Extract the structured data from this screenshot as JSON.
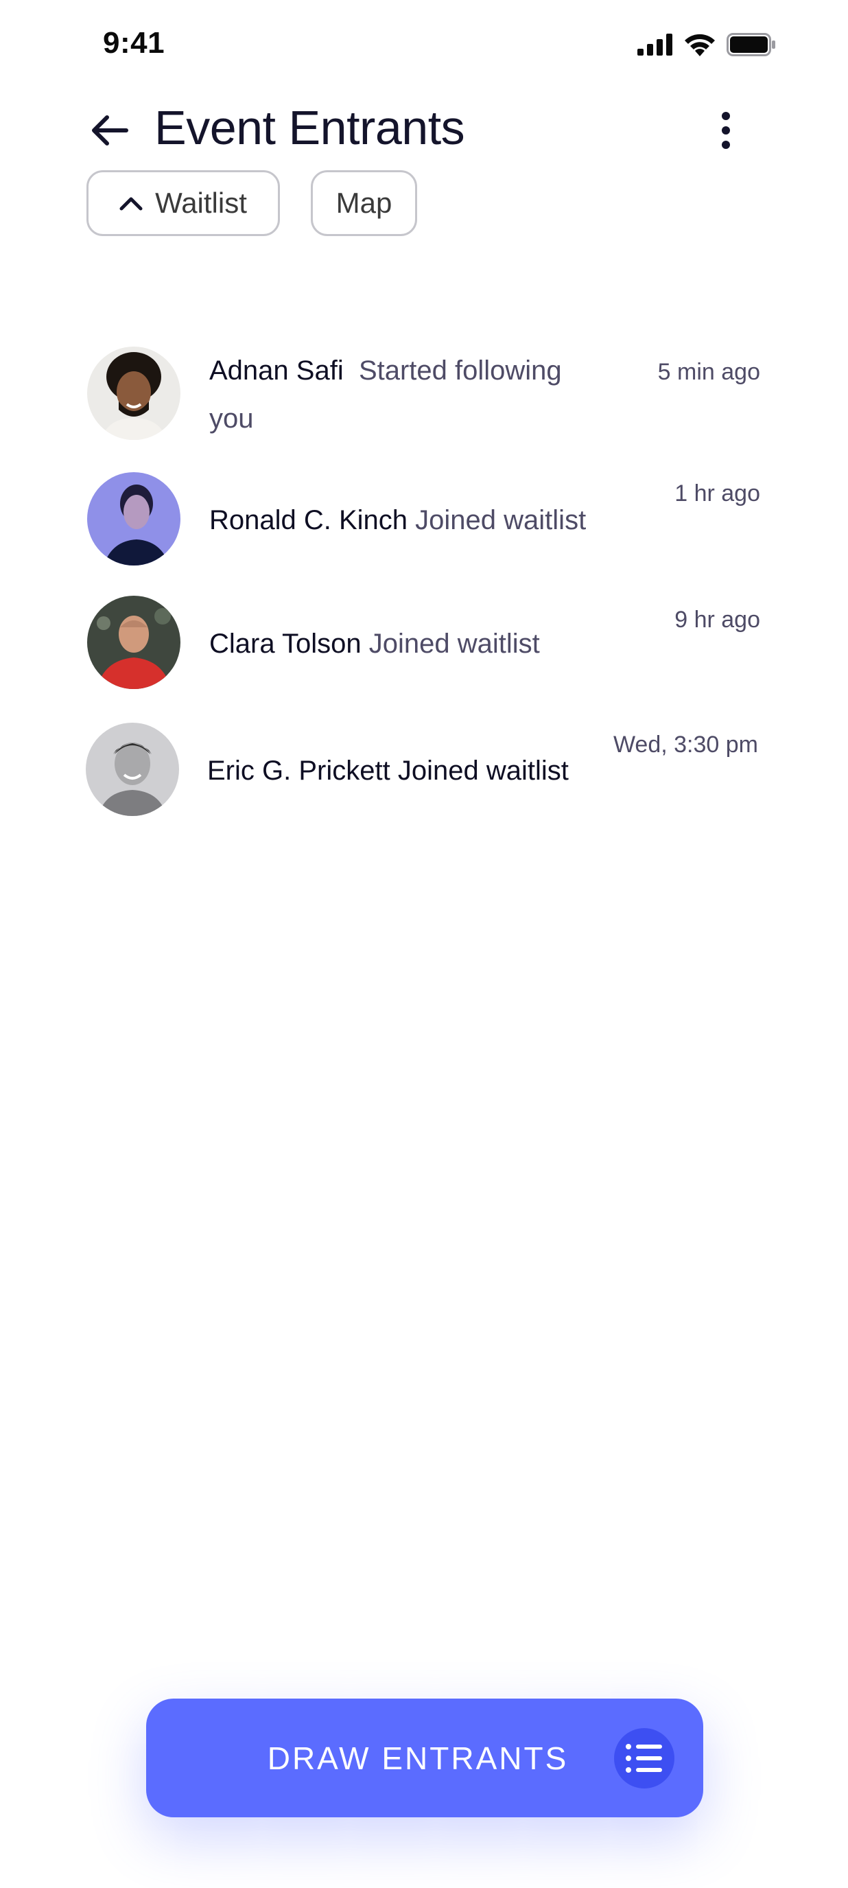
{
  "status_bar": {
    "time": "9:41"
  },
  "header": {
    "title": "Event Entrants"
  },
  "filters": [
    {
      "label": "Waitlist",
      "icon": "chevron-up-icon"
    },
    {
      "label": "Map"
    }
  ],
  "entries": [
    {
      "name": "Adnan Safi",
      "action": "Started following you",
      "time": "5 min ago"
    },
    {
      "name": "Ronald C. Kinch",
      "action": "Joined waitlist",
      "time": "1 hr ago"
    },
    {
      "name": "Clara Tolson",
      "action": "Joined waitlist",
      "time": "9 hr ago"
    },
    {
      "name": "Eric G. Prickett",
      "action": "Joined waitlist",
      "time": "Wed, 3:30 pm"
    }
  ],
  "cta": {
    "label": "DRAW ENTRANTS",
    "icon": "list-icon"
  },
  "colors": {
    "accent": "#5b6cff",
    "accent_dark": "#3d4ff2",
    "text_primary": "#14142b",
    "text_secondary": "#4e4b66"
  }
}
